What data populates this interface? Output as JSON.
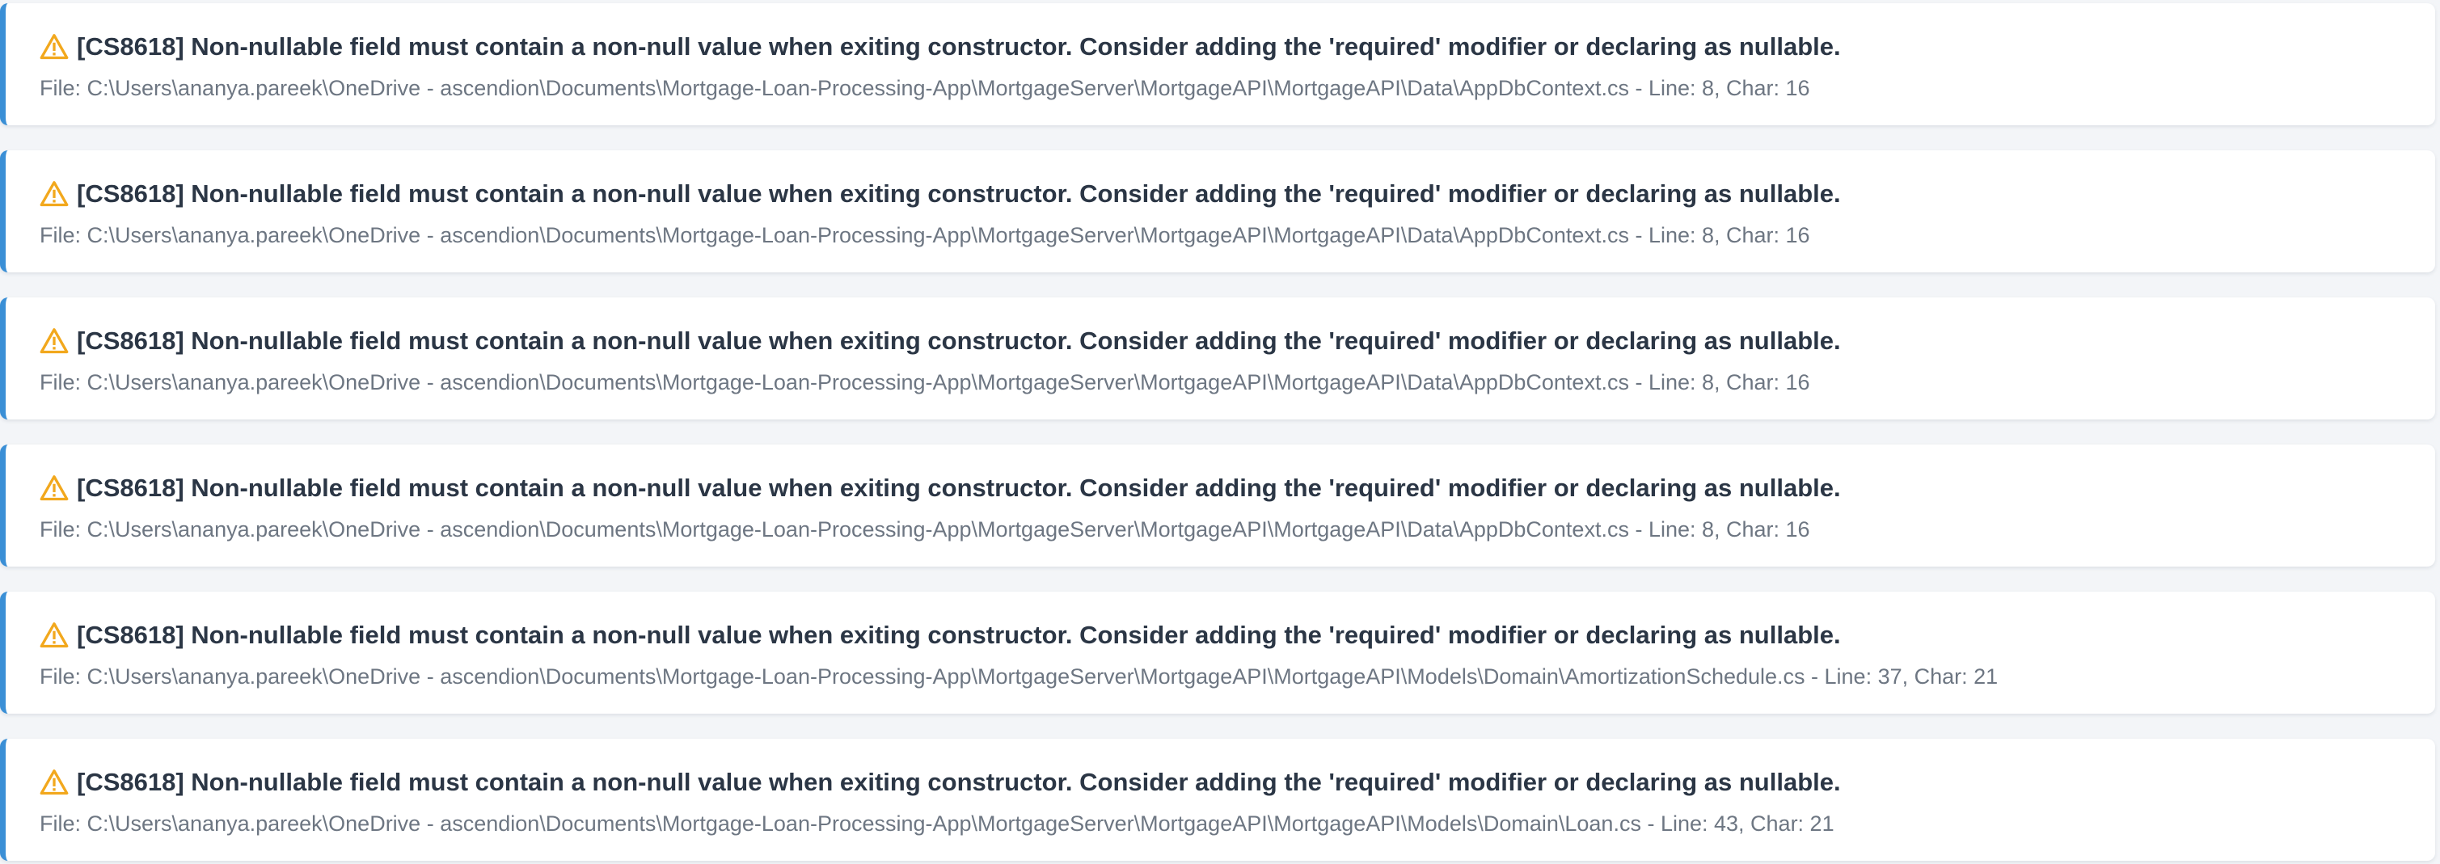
{
  "colors": {
    "accent": "#3a8fd6",
    "warning": "#f2a81d",
    "title_text": "#2b3645",
    "path_text": "#6d7682",
    "background": "#f3f5f8"
  },
  "warnings": [
    {
      "icon": "warning-icon",
      "message": "[CS8618] Non-nullable field must contain a non-null value when exiting constructor. Consider adding the 'required' modifier or declaring as nullable.",
      "location": "File: C:\\Users\\ananya.pareek\\OneDrive - ascendion\\Documents\\Mortgage-Loan-Processing-App\\MortgageServer\\MortgageAPI\\MortgageAPI\\Data\\AppDbContext.cs - Line: 8, Char: 16"
    },
    {
      "icon": "warning-icon",
      "message": "[CS8618] Non-nullable field must contain a non-null value when exiting constructor. Consider adding the 'required' modifier or declaring as nullable.",
      "location": "File: C:\\Users\\ananya.pareek\\OneDrive - ascendion\\Documents\\Mortgage-Loan-Processing-App\\MortgageServer\\MortgageAPI\\MortgageAPI\\Data\\AppDbContext.cs - Line: 8, Char: 16"
    },
    {
      "icon": "warning-icon",
      "message": "[CS8618] Non-nullable field must contain a non-null value when exiting constructor. Consider adding the 'required' modifier or declaring as nullable.",
      "location": "File: C:\\Users\\ananya.pareek\\OneDrive - ascendion\\Documents\\Mortgage-Loan-Processing-App\\MortgageServer\\MortgageAPI\\MortgageAPI\\Data\\AppDbContext.cs - Line: 8, Char: 16"
    },
    {
      "icon": "warning-icon",
      "message": "[CS8618] Non-nullable field must contain a non-null value when exiting constructor. Consider adding the 'required' modifier or declaring as nullable.",
      "location": "File: C:\\Users\\ananya.pareek\\OneDrive - ascendion\\Documents\\Mortgage-Loan-Processing-App\\MortgageServer\\MortgageAPI\\MortgageAPI\\Data\\AppDbContext.cs - Line: 8, Char: 16"
    },
    {
      "icon": "warning-icon",
      "message": "[CS8618] Non-nullable field must contain a non-null value when exiting constructor. Consider adding the 'required' modifier or declaring as nullable.",
      "location": "File: C:\\Users\\ananya.pareek\\OneDrive - ascendion\\Documents\\Mortgage-Loan-Processing-App\\MortgageServer\\MortgageAPI\\MortgageAPI\\Models\\Domain\\AmortizationSchedule.cs - Line: 37, Char: 21"
    },
    {
      "icon": "warning-icon",
      "message": "[CS8618] Non-nullable field must contain a non-null value when exiting constructor. Consider adding the 'required' modifier or declaring as nullable.",
      "location": "File: C:\\Users\\ananya.pareek\\OneDrive - ascendion\\Documents\\Mortgage-Loan-Processing-App\\MortgageServer\\MortgageAPI\\MortgageAPI\\Models\\Domain\\Loan.cs - Line: 43, Char: 21"
    }
  ]
}
